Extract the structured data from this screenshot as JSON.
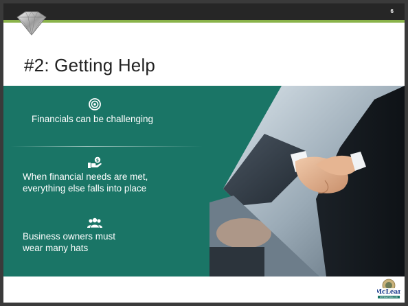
{
  "slide": {
    "page_number": "6",
    "title": "#2: Getting Help",
    "items": [
      {
        "icon": "target-icon",
        "text": "Financials can be challenging"
      },
      {
        "icon": "hand-money-icon",
        "text_line1": "When financial needs are met,",
        "text_line2": "everything else falls into place"
      },
      {
        "icon": "people-group-icon",
        "text_line1": "Business owners must",
        "text_line2": "wear many hats"
      }
    ],
    "logo_text": "McLean",
    "logo_subtext": "INTERNATIONAL LTD"
  },
  "colors": {
    "topbar": "#262626",
    "accent_green": "#8ab34a",
    "banner_teal": "#1a7566"
  }
}
